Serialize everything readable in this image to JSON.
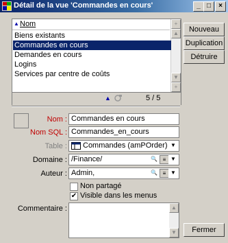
{
  "window": {
    "title": "Détail de la vue 'Commandes en cours'",
    "controls": {
      "minimize": "_",
      "maximize": "□",
      "close": "×"
    }
  },
  "list": {
    "header": "Nom",
    "items": [
      {
        "label": "Biens existants",
        "selected": false
      },
      {
        "label": "Commandes en cours",
        "selected": true
      },
      {
        "label": "Demandes en cours",
        "selected": false
      },
      {
        "label": "Logins",
        "selected": false
      },
      {
        "label": "Services par centre de coûts",
        "selected": false
      }
    ],
    "counter": "5 / 5"
  },
  "actions": {
    "nouveau": "Nouveau",
    "duplication": "Duplication",
    "detruire": "Détruire",
    "fermer": "Fermer"
  },
  "form": {
    "nom_label": "Nom :",
    "nom_value": "Commandes en cours",
    "nomsql_label": "Nom SQL :",
    "nomsql_value": "Commandes_en_cours",
    "table_label": "Table :",
    "table_value": "Commandes (amPOrder)",
    "domaine_label": "Domaine :",
    "domaine_value": "/Finance/",
    "auteur_label": "Auteur :",
    "auteur_value": "Admin,",
    "non_partage_label": "Non partagé",
    "non_partage_checked": false,
    "visible_label": "Visible dans les menus",
    "visible_checked": true,
    "commentaire_label": "Commentaire :",
    "commentaire_value": ""
  },
  "colors": {
    "title_bar": "#0a246a",
    "selection": "#0a246a",
    "required_label": "#c00000"
  }
}
